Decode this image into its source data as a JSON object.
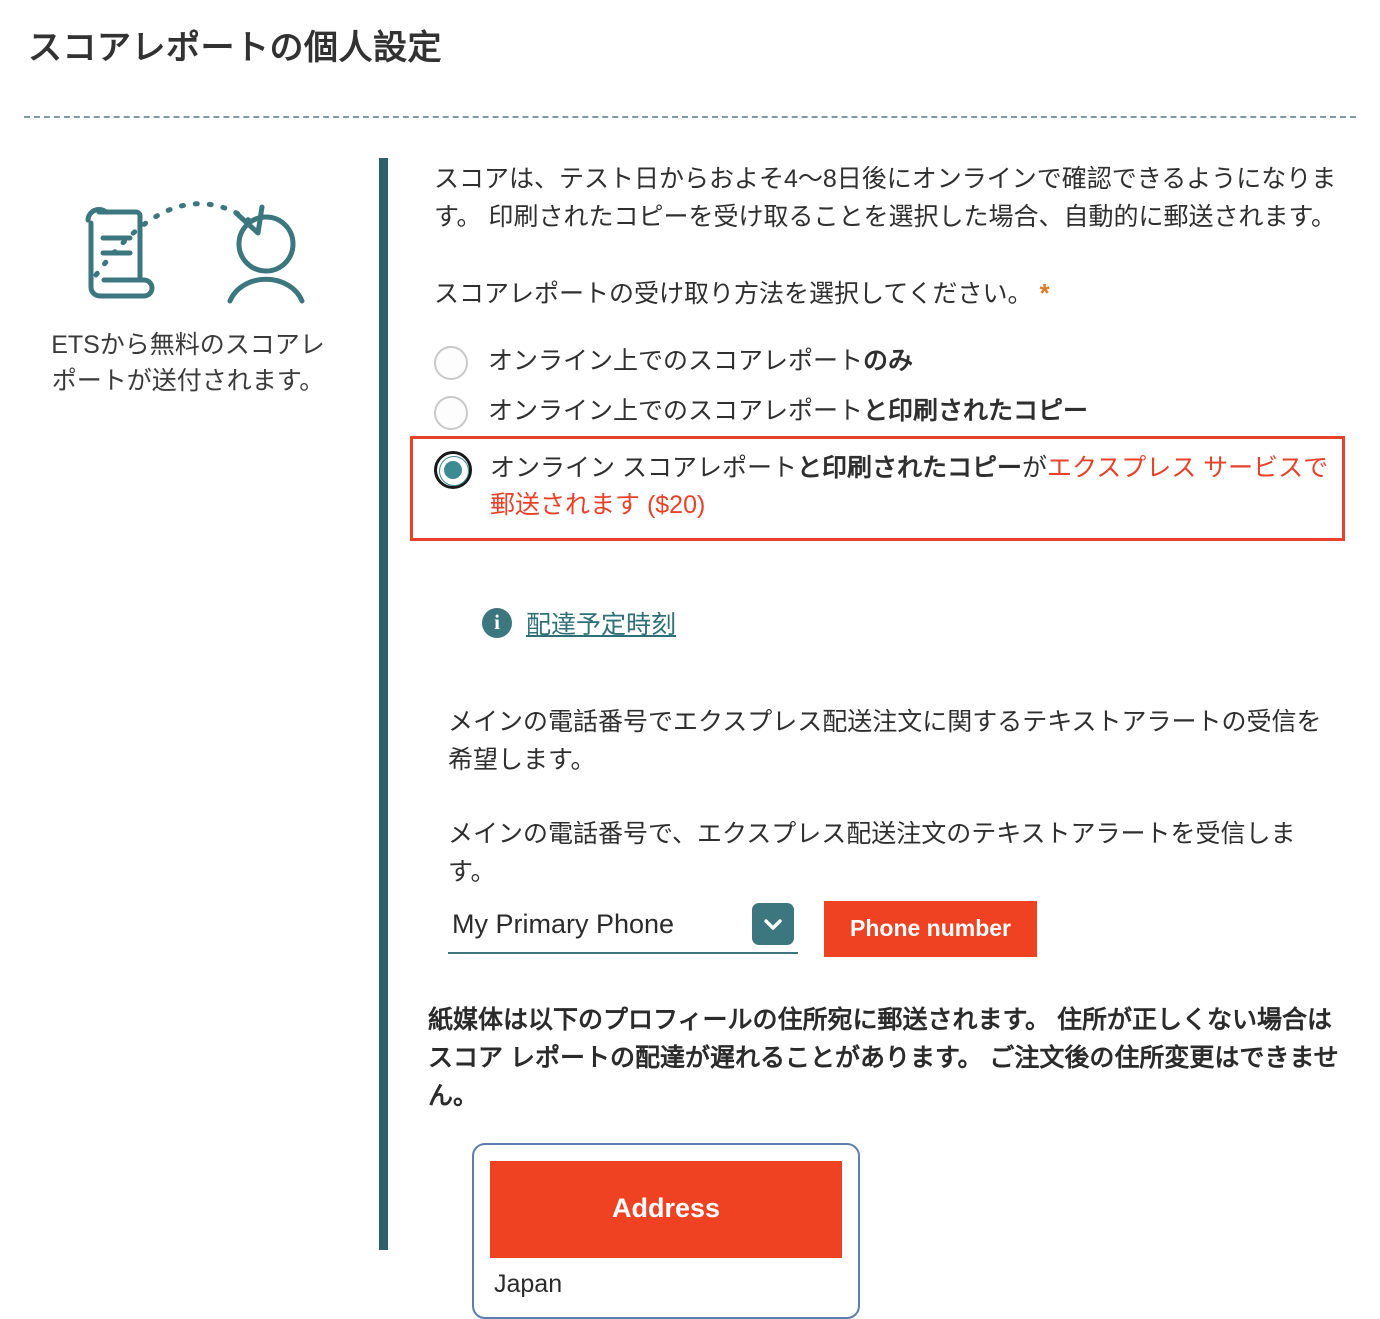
{
  "page": {
    "title": "スコアレポートの個人設定"
  },
  "left_panel": {
    "icon_name": "scroll-to-person-icon",
    "caption": "ETSから無料のスコアレポートが送付されます。"
  },
  "main": {
    "intro_paragraph": "スコアは、テスト日からおよそ4〜8日後にオンラインで確認できるようになります。 印刷されたコピーを受け取ることを選択した場合、自動的に郵送されます。",
    "選択_prompt": "スコアレポートの受け取り方法を選択してください。",
    "required_marker": "*",
    "radio_options": [
      {
        "id": "online-only",
        "text_plain": "オンライン上でのスコアレポート",
        "text_bold": "のみ",
        "selected": false
      },
      {
        "id": "online-and-printed",
        "text_plain": "オンライン上でのスコアレポート",
        "text_bold": "と印刷されたコピー",
        "selected": false
      },
      {
        "id": "online-printed-express",
        "text_plain": "オンライン スコアレポート",
        "text_bold": "と印刷されたコピー",
        "text_after": "が",
        "text_express": "エクスプレス サービスで郵送されます ($20)",
        "selected": true
      }
    ],
    "info_link": {
      "icon_name": "info-icon",
      "icon_glyph": "i",
      "label": "配達予定時刻"
    },
    "sms_paragraph_1": "メインの電話番号でエクスプレス配送注文に関するテキストアラートの受信を希望します。",
    "sms_paragraph_2": "メインの電話番号で、エクスプレス配送注文のテキストアラートを受信します。",
    "phone_select": {
      "value": "My Primary Phone",
      "chevron_icon": "chevron-down-icon"
    },
    "phone_number_button": "Phone number",
    "mailing_notice": "紙媒体は以下のプロフィールの住所宛に郵送されます。 住所が正しくない場合はスコア レポートの配達が遅れることがあります。 ご注文後の住所変更はできません。",
    "address_card": {
      "banner_label": "Address",
      "country": "Japan"
    }
  },
  "colors": {
    "teal": "#2e6069",
    "teal_accent": "#3c767e",
    "red": "#ee4223",
    "red_border": "#e8412a",
    "orange_star": "#e07b28",
    "card_border": "#5d7fad"
  }
}
